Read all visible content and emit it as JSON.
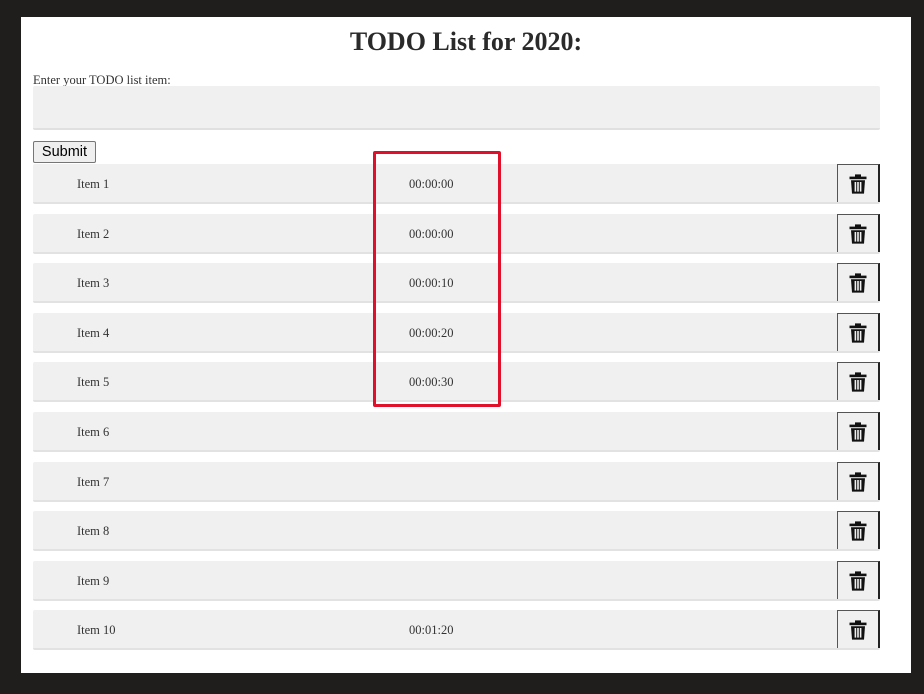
{
  "header": {
    "title": "TODO List for 2020:"
  },
  "form": {
    "label": "Enter your TODO list item:",
    "input_value": "",
    "submit_label": "Submit"
  },
  "items": [
    {
      "label": "Item 1",
      "time": "00:00:00"
    },
    {
      "label": "Item 2",
      "time": "00:00:00"
    },
    {
      "label": "Item 3",
      "time": "00:00:10"
    },
    {
      "label": "Item 4",
      "time": "00:00:20"
    },
    {
      "label": "Item 5",
      "time": "00:00:30"
    },
    {
      "label": "Item 6",
      "time": ""
    },
    {
      "label": "Item 7",
      "time": ""
    },
    {
      "label": "Item 8",
      "time": ""
    },
    {
      "label": "Item 9",
      "time": ""
    },
    {
      "label": "Item 10",
      "time": "00:01:20"
    }
  ],
  "icons": {
    "delete": "trash-icon"
  },
  "colors": {
    "highlight": "#e0102a",
    "row_background": "#f0f0f0",
    "outer_background": "#1f1e1c"
  }
}
